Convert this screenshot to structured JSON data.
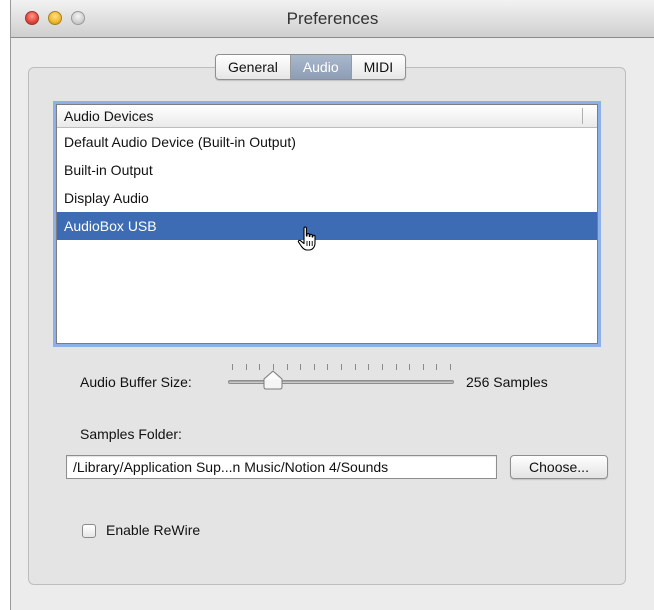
{
  "window": {
    "title": "Preferences"
  },
  "tabs": [
    {
      "label": "General",
      "active": false
    },
    {
      "label": "Audio",
      "active": true
    },
    {
      "label": "MIDI",
      "active": false
    }
  ],
  "devices": {
    "header": "Audio Devices",
    "items": [
      "Default Audio Device (Built-in Output)",
      "Built-in Output",
      "Display Audio",
      "AudioBox USB"
    ],
    "selected_index": 3
  },
  "buffer": {
    "label": "Audio Buffer Size:",
    "value_text": "256 Samples",
    "slider_fraction": 0.2
  },
  "samples_folder": {
    "label": "Samples Folder:",
    "path": "/Library/Application Sup...n Music/Notion 4/Sounds",
    "choose_label": "Choose..."
  },
  "rewire": {
    "label": "Enable ReWire",
    "checked": false
  },
  "colors": {
    "selection": "#3d6cb4",
    "focus_ring": "#8bb1e6",
    "active_tab": "#8d9db5"
  },
  "icons": {
    "cursor": "pointing-hand-cursor"
  }
}
